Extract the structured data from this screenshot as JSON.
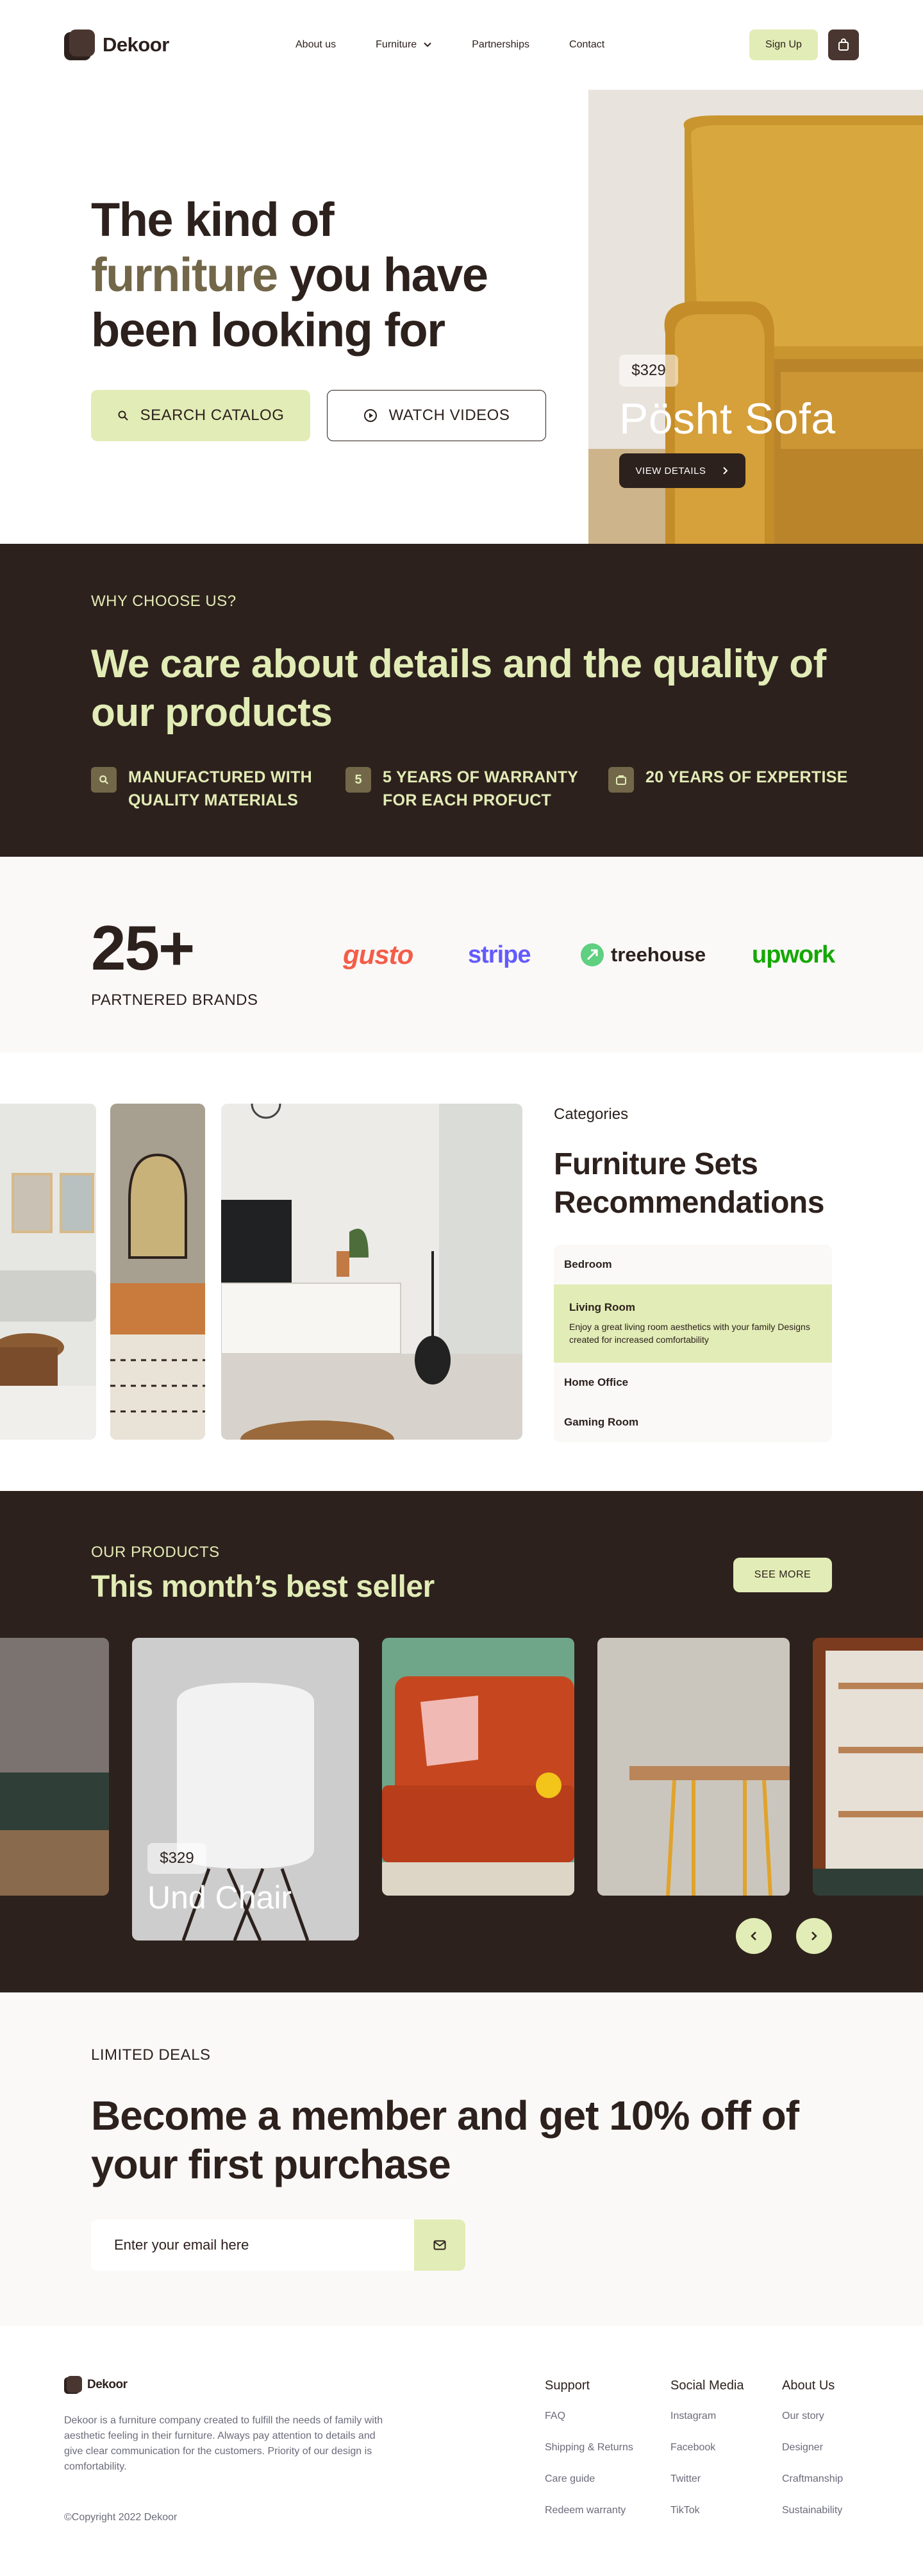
{
  "nav": {
    "logo_text": "Dekoor",
    "links": [
      "About us",
      "Furniture",
      "Partnerships",
      "Contact"
    ],
    "signup": "Sign Up"
  },
  "hero": {
    "title_part1": "The kind of",
    "title_accent": "furniture",
    "title_part2": "you have been looking for",
    "search_button": "SEARCH CATALOG",
    "watch_button": "WATCH VIDEOS",
    "product_price": "$329",
    "product_name": "Pösht Sofa",
    "view_details": "VIEW DETAILS"
  },
  "why": {
    "eyebrow": "WHY CHOOSE US?",
    "title": "We care about details and the quality of our products",
    "features": [
      {
        "icon": "search-icon",
        "text": "MANUFACTURED WITH QUALITY MATERIALS"
      },
      {
        "icon": "number-five-icon",
        "icon_text": "5",
        "text": "5 YEARS OF WARRANTY FOR EACH PROFUCT"
      },
      {
        "icon": "briefcase-icon",
        "text": "20 YEARS OF EXPERTISE"
      }
    ]
  },
  "brands": {
    "count": "25+",
    "label": "PARTNERED BRANDS",
    "logos": [
      "gusto",
      "stripe",
      "treehouse",
      "upwork"
    ]
  },
  "categories": {
    "eyebrow": "Categories",
    "title": "Furniture Sets Recommendations",
    "items": [
      {
        "label": "Bedroom"
      },
      {
        "label": "Living Room",
        "description": "Enjoy a great living room aesthetics with your family Designs created for increased comfortability"
      },
      {
        "label": "Home Office"
      },
      {
        "label": "Gaming Room"
      }
    ]
  },
  "best": {
    "eyebrow": "OUR PRODUCTS",
    "title": "This month’s best seller",
    "see_more": "SEE MORE",
    "featured_price": "$329",
    "featured_name": "Und Chair"
  },
  "deals": {
    "eyebrow": "LIMITED DEALS",
    "title": "Become a member and get 10% off of your first purchase",
    "email_placeholder": "Enter your email here"
  },
  "footer": {
    "logo_text": "Dekoor",
    "description": "Dekoor is a furniture company created to fulfill the needs of family with aesthetic feeling in their furniture. Always pay attention to details and give clear communication for the customers. Priority of our design is comfortability.",
    "copyright": "©Copyright 2022 Dekoor",
    "columns": [
      {
        "title": "Support",
        "links": [
          "FAQ",
          "Shipping & Returns",
          "Care guide",
          "Redeem warranty"
        ]
      },
      {
        "title": "Social Media",
        "links": [
          "Instagram",
          "Facebook",
          "Twitter",
          "TikTok"
        ]
      },
      {
        "title": "About Us",
        "links": [
          "Our story",
          "Designer",
          "Craftmanship",
          "Sustainability"
        ]
      }
    ]
  },
  "colors": {
    "dark": "#2d211d",
    "accent_light": "#e2ecb6",
    "accent_olive": "#736749",
    "off_white": "#fbf9f8"
  }
}
